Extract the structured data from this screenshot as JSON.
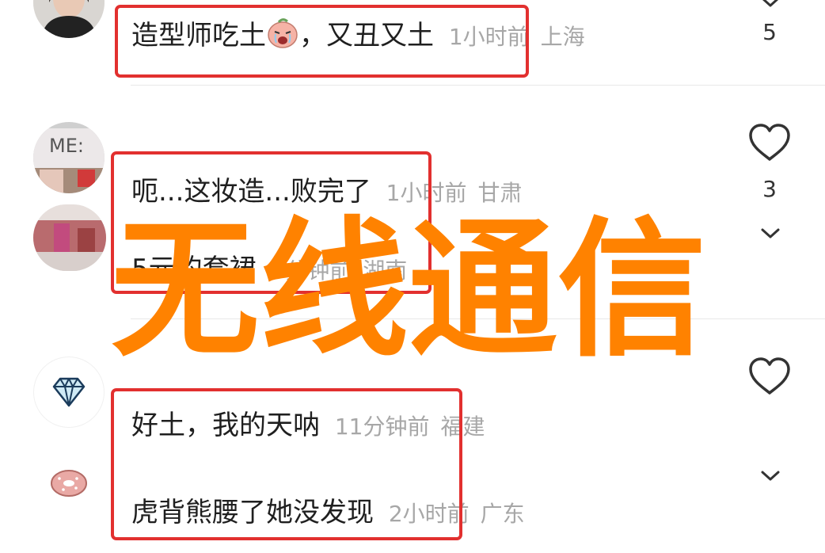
{
  "comments": [
    {
      "text": "造型师吃土",
      "text_after_emoji": "，又丑又土",
      "emoji": "crying-peach-emoji",
      "time": "1小时前",
      "location": "上海",
      "likes": "5"
    },
    {
      "text": "呃...这妆造...败完了",
      "time": "1小时前",
      "location": "甘肃",
      "likes": "3"
    },
    {
      "text": "5元的套裙",
      "time": "9分钟前",
      "location": "湖南"
    },
    {
      "text": "好土，我的天呐",
      "time": "11分钟前",
      "location": "福建"
    },
    {
      "text": "虎背熊腰了她没发现",
      "time": "2小时前",
      "location": "广东"
    }
  ],
  "watermark": "无线通信",
  "colors": {
    "highlight": "#e2302f",
    "watermark": "#ff8200",
    "meta": "#a7a7a7"
  },
  "icons": {
    "like": "heart-outline-icon",
    "expand": "chevron-down-icon",
    "avatar_diamond": "diamond-icon",
    "avatar_donut": "donut-icon"
  }
}
